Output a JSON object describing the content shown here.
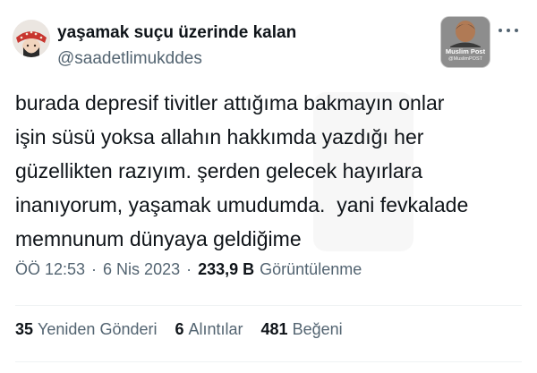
{
  "author": {
    "display_name": "yaşamak suçu üzerinde kalan",
    "handle": "@saadetlimukddes",
    "avatar_icon": "profile-photo-icon"
  },
  "watermark_badge": {
    "name": "Muslim Post",
    "handle": "@MuslimPOST"
  },
  "more_icon": "more-dots-icon",
  "tweet": {
    "lines": [
      "burada depresif tivitler attığıma bakmayın onlar",
      "işin süsü yoksa allahın hakkımda yazdığı her",
      "güzellikten razıyım. şerden gelecek hayırlara",
      "inanıyorum, yaşamak umudumda.  yani fevkalade",
      "memnunum dünyaya geldiğime"
    ]
  },
  "meta": {
    "time": "ÖÖ 12:53",
    "separator": "·",
    "date": "6 Nis 2023",
    "views_count": "233,9 B",
    "views_label": "Görüntülenme"
  },
  "stats": {
    "retweets_count": "35",
    "retweets_label": "Yeniden Gönderi",
    "quotes_count": "6",
    "quotes_label": "Alıntılar",
    "likes_count": "481",
    "likes_label": "Beğeni"
  },
  "colors": {
    "text_primary": "#0f1419",
    "text_secondary": "#536471",
    "divider": "#eff3f4"
  }
}
